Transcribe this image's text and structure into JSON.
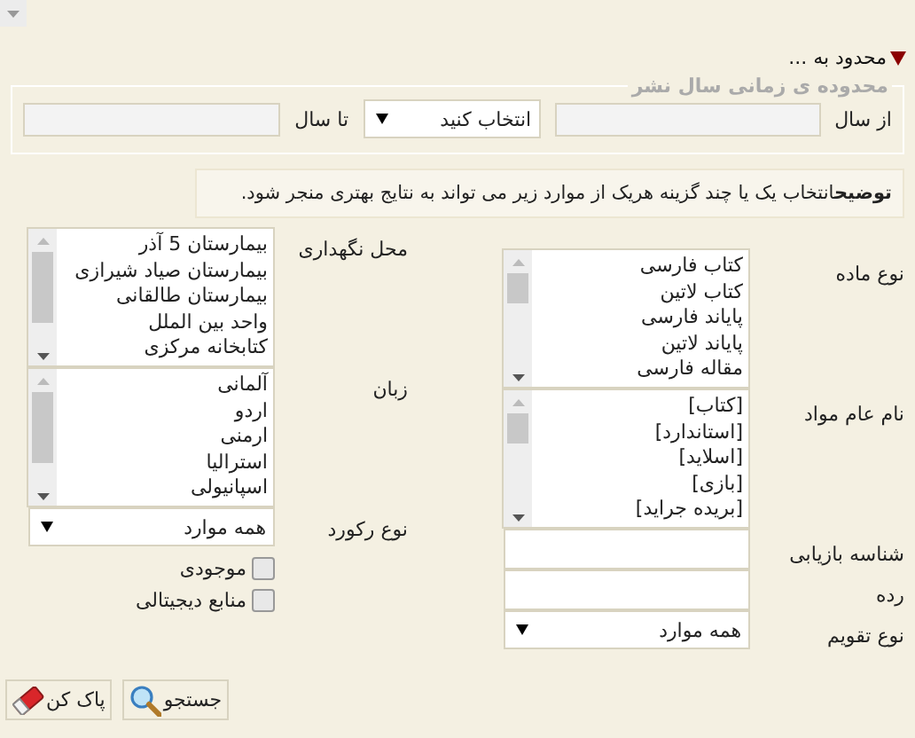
{
  "section": {
    "title": "محدود به ...",
    "expanded": true
  },
  "year_range": {
    "legend": "محدوده ی زمانی سال نشر",
    "from_label": "از سال",
    "mode_select": "انتخاب کنید",
    "to_label": "تا سال"
  },
  "hint": {
    "title": "توضیح",
    "text": "انتخاب یک یا چند گزینه هریک از موارد زیر می تواند به نتایج بهتری منجر شود."
  },
  "right_fields": [
    {
      "kind": "listbox",
      "label": "نوع ماده",
      "items": [
        "کتاب فارسی",
        "کتاب لاتین",
        "پایاند فارسی",
        "پایاند لاتین",
        "مقاله فارسی"
      ]
    },
    {
      "kind": "listbox",
      "label": "نام عام مواد",
      "items": [
        "[کتاب]",
        "[استاندارد]",
        "[اسلاید]",
        "[بازی]",
        "[بریده جراید]"
      ]
    },
    {
      "kind": "input",
      "label": "شناسه بازیابی"
    },
    {
      "kind": "input",
      "label": "رده"
    },
    {
      "kind": "select",
      "label": "نوع تقویم",
      "value": "همه موارد"
    }
  ],
  "left_fields": [
    {
      "kind": "listbox",
      "label": "محل نگهداری",
      "items": [
        "بیمارستان 5 آذر",
        "بیمارستان صیاد شیرازی",
        "بیمارستان طالقانی",
        "واحد بین الملل",
        "کتابخانه مرکزی"
      ]
    },
    {
      "kind": "listbox",
      "label": "زبان",
      "items": [
        "آلمانی",
        "اردو",
        "ارمنی",
        "استرالیا",
        "اسپانیولی"
      ]
    },
    {
      "kind": "select",
      "label": "نوع رکورد",
      "value": "همه موارد"
    },
    {
      "kind": "checkbox",
      "label": "موجودی",
      "checked": false
    },
    {
      "kind": "checkbox",
      "label": "منابع دیجیتالی",
      "checked": false
    }
  ],
  "buttons": [
    {
      "kind": "search",
      "label": "جستجو"
    },
    {
      "kind": "clear",
      "label": "پاک کن"
    }
  ]
}
